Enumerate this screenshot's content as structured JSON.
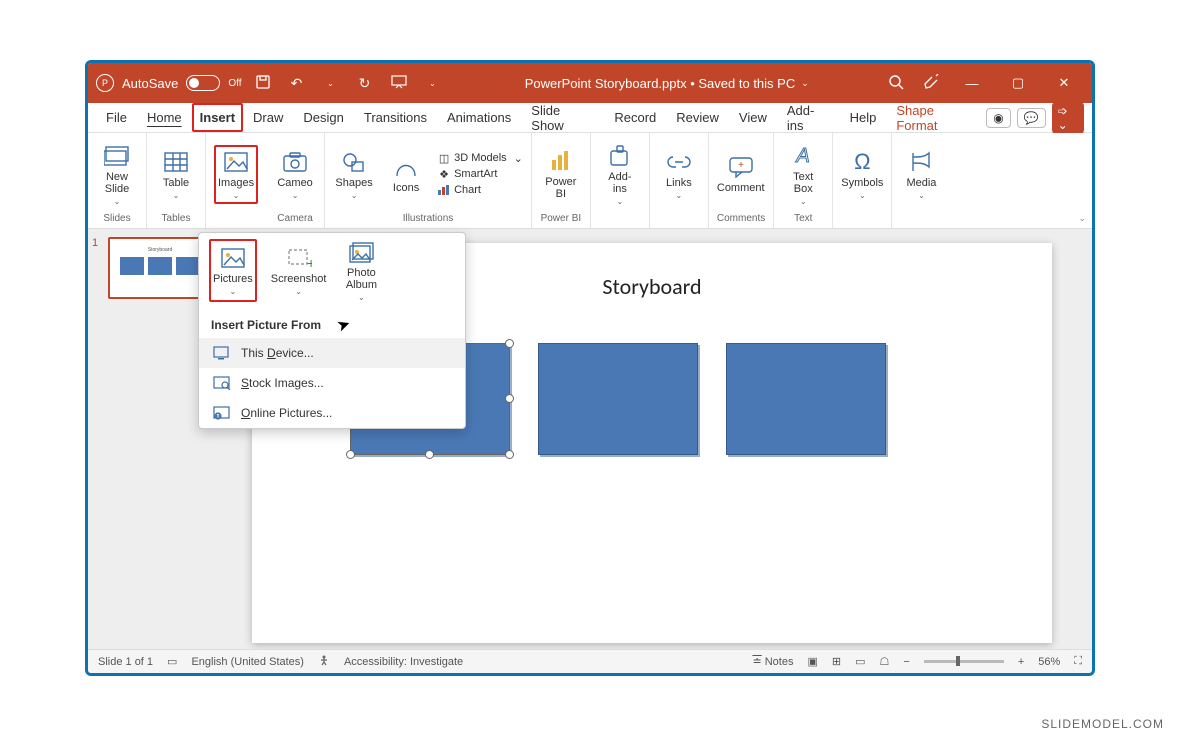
{
  "titlebar": {
    "autosave_label": "AutoSave",
    "autosave_state": "Off",
    "doc_title": "PowerPoint Storyboard.pptx • Saved to this PC"
  },
  "tabs": {
    "file": "File",
    "home": "Home",
    "insert": "Insert",
    "draw": "Draw",
    "design": "Design",
    "transitions": "Transitions",
    "animations": "Animations",
    "slideshow": "Slide Show",
    "record": "Record",
    "review": "Review",
    "view": "View",
    "addins": "Add-ins",
    "help": "Help",
    "shapeformat": "Shape Format"
  },
  "ribbon": {
    "slides": {
      "new_slide": "New\nSlide",
      "group": "Slides"
    },
    "tables": {
      "table": "Table",
      "group": "Tables"
    },
    "images": {
      "images": "Images",
      "cameo": "Cameo",
      "group": "Camera"
    },
    "ill": {
      "shapes": "Shapes",
      "icons": "Icons",
      "models": "3D Models",
      "smartart": "SmartArt",
      "chart": "Chart",
      "group": "Illustrations"
    },
    "powerbi": {
      "btn": "Power\nBI",
      "group": "Power BI"
    },
    "addins": {
      "btn": "Add-\nins"
    },
    "links": {
      "btn": "Links"
    },
    "comments": {
      "btn": "Comment",
      "group": "Comments"
    },
    "text": {
      "textbox": "Text\nBox",
      "group": "Text"
    },
    "symbols": {
      "btn": "Symbols"
    },
    "media": {
      "btn": "Media"
    }
  },
  "images_dropdown": {
    "pictures": "Pictures",
    "screenshot": "Screenshot",
    "photoalbum": "Photo\nAlbum",
    "header": "Insert Picture From",
    "this_device": "This Device...",
    "stock": "Stock Images...",
    "online": "Online Pictures..."
  },
  "slide": {
    "title": "Storyboard",
    "thumb_title": "Storyboard",
    "thumb_index": "1"
  },
  "statusbar": {
    "slide_of": "Slide 1 of 1",
    "lang": "English (United States)",
    "access": "Accessibility: Investigate",
    "notes": "Notes",
    "zoom": "56%"
  },
  "attribution": "SLIDEMODEL.COM"
}
